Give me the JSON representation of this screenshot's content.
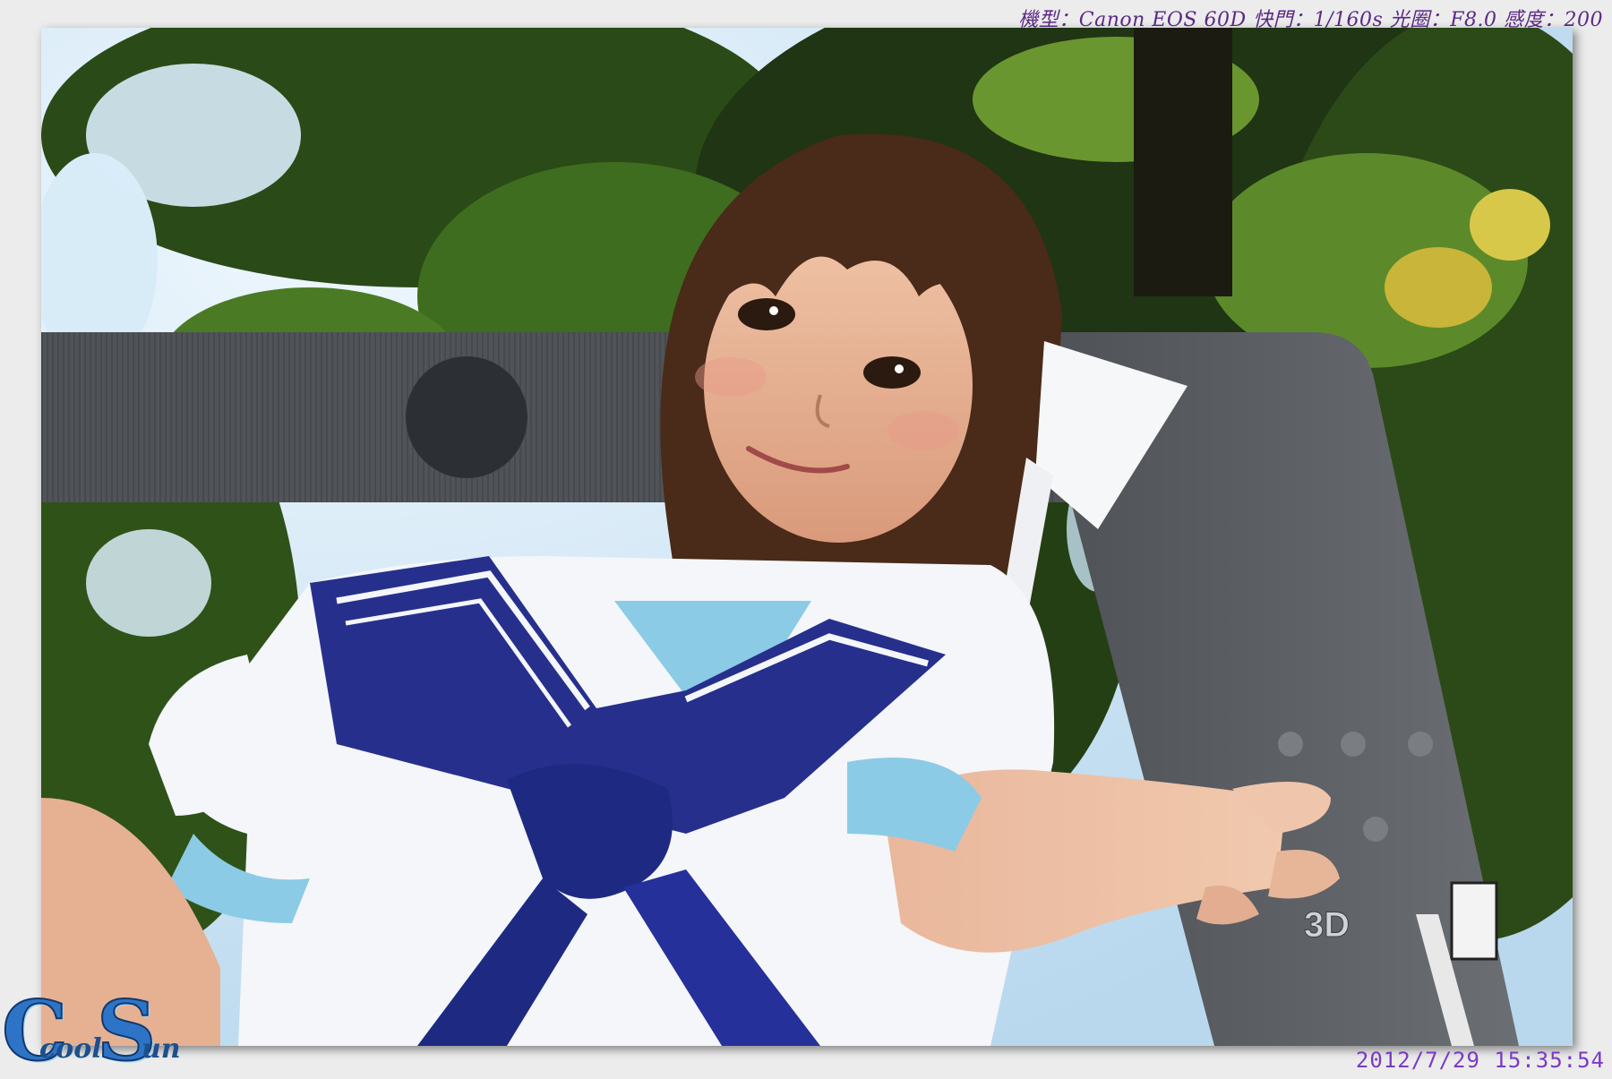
{
  "exif": {
    "text": "機型：Canon EOS 60D 快門：1/160s 光圈：F8.0 感度：200"
  },
  "datestamp": {
    "text": "2012/7/29 15:35:54"
  },
  "watermark": {
    "letter1": "C",
    "small1": "cool",
    "letter2": "S",
    "small2": "un"
  },
  "photo": {
    "prop_label": "3D",
    "colors": {
      "sky": "#d8ecf8",
      "foliage_dark": "#1f3513",
      "foliage_mid": "#3f6d1f",
      "foliage_light": "#7ea33a",
      "frame_prop": "#5c5f63",
      "sailor_collar": "#26308c",
      "uniform_white": "#f4f6fa",
      "uniform_light_blue": "#8ccbe6",
      "hair": "#4a2a18",
      "skin": "#e8b598"
    }
  }
}
